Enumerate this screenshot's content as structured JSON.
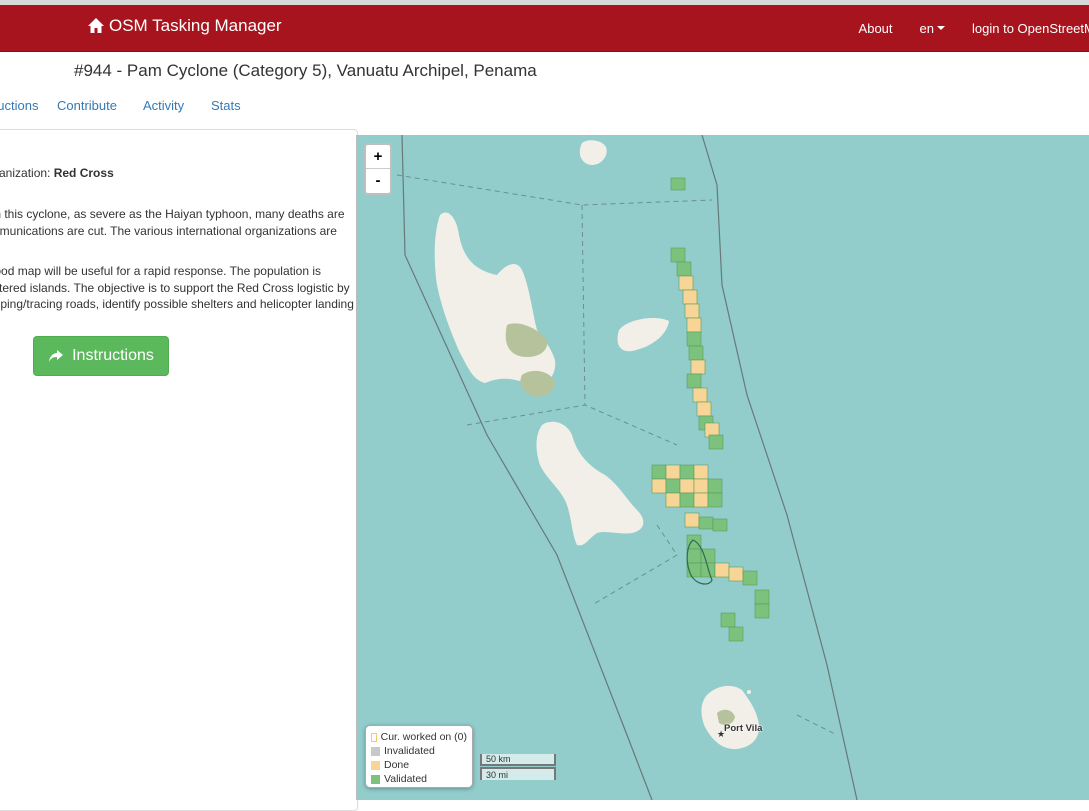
{
  "navbar": {
    "brand": "OSM Tasking Manager",
    "about": "About",
    "lang": "en",
    "login": "login to OpenStreetMap"
  },
  "project": {
    "title": "#944 - Pam Cyclone (Category 5), Vanuatu Archipel, Penama"
  },
  "tabs": {
    "description": "Instructions",
    "contribute": "Contribute",
    "activity": "Activity",
    "stats": "Stats"
  },
  "panel": {
    "org_label": "Organization: ",
    "org_value": "Red Cross",
    "para1": [
      "With this cyclone, as severe as the Haiyan typhoon, many deaths are",
      "communications are cut. The various international organizations are"
    ],
    "para2": [
      "A good map will be useful for a rapid response. The population is",
      "scattered islands. The objective is to support the Red Cross logistic by",
      "mapping/tracing roads, identify possible shelters and helicopter landing"
    ],
    "instructions_button": "Instructions"
  },
  "map": {
    "zoom_in": "+",
    "zoom_out": "-",
    "legend": {
      "current": "Cur. worked on (0)",
      "invalidated": "Invalidated",
      "done": "Done",
      "validated": "Validated"
    },
    "scale": {
      "km": "50 km",
      "mi": "30 mi"
    },
    "place": "Port Vila",
    "colors": {
      "sea": "#92cdcc",
      "land": "#f2efe9",
      "done": "#f6d596",
      "validated": "#7cc17c",
      "navbar": "#a8141e"
    }
  }
}
